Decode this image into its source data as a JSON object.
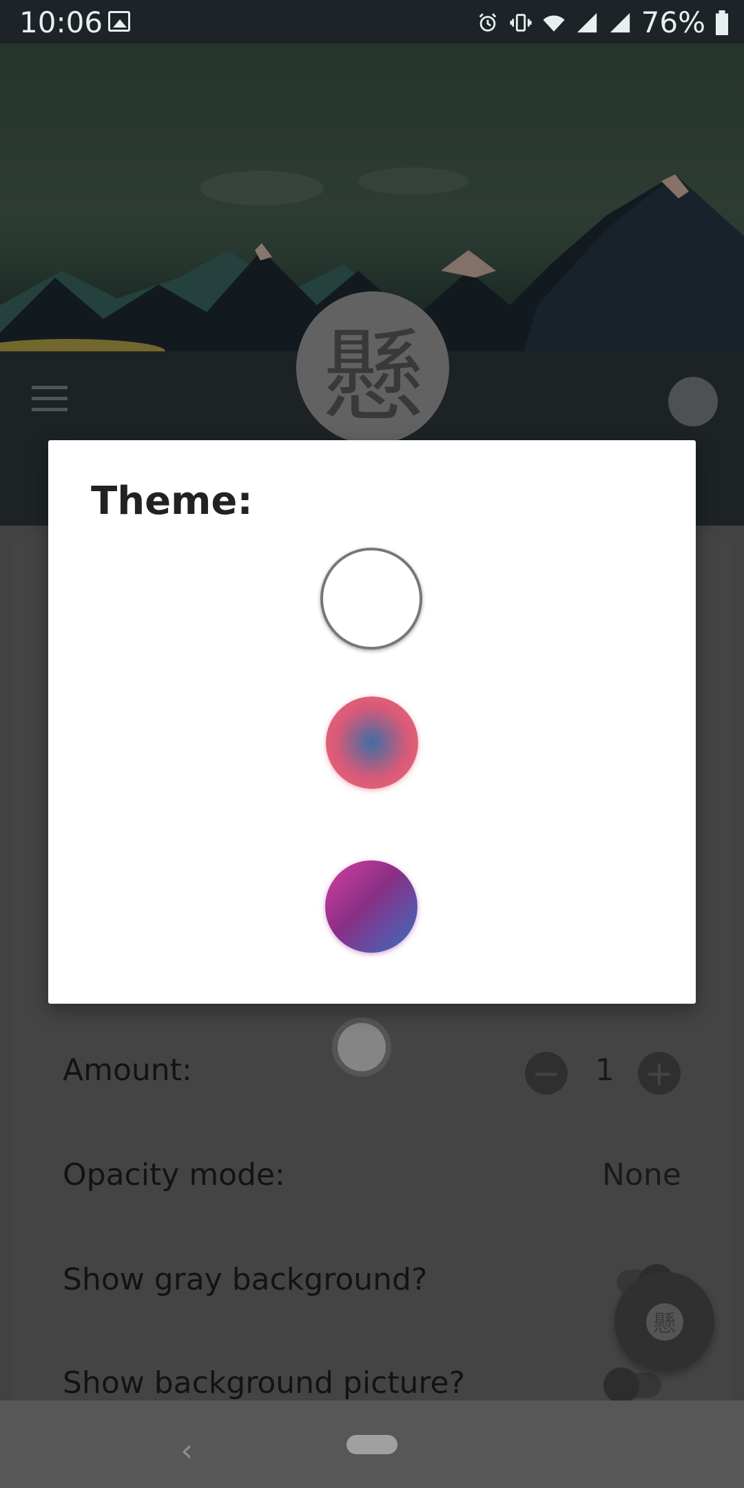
{
  "status_bar": {
    "time": "10:06",
    "battery": "76%"
  },
  "header": {
    "avatar_glyph": "懸"
  },
  "settings": {
    "amount_label": "Amount:",
    "amount_value": "1",
    "opacity_label": "Opacity mode:",
    "opacity_value": "None",
    "gray_bg_label": "Show gray background?",
    "bg_picture_label": "Show background picture?"
  },
  "fab": {
    "glyph": "懸"
  },
  "dialog": {
    "title": "Theme:",
    "options": [
      {
        "name": "white",
        "color": "#ffffff"
      },
      {
        "name": "radial",
        "colors": [
          "#3f6ea3",
          "#ee6a76"
        ]
      },
      {
        "name": "linear",
        "colors": [
          "#d43fa0",
          "#3a6ec0"
        ]
      }
    ]
  },
  "nav": {
    "back": "‹"
  }
}
